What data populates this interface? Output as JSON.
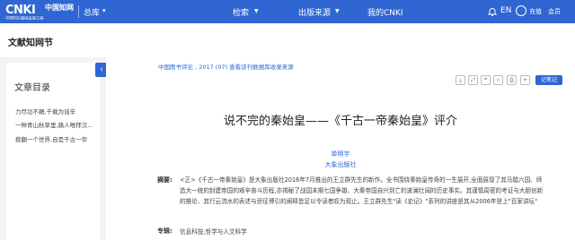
{
  "header": {
    "logo_mark": "CNKI",
    "logo_cn": "中国知网",
    "logo_sub": "中国知识基础设施工程",
    "home_label": "总库",
    "nav": [
      "检索",
      "出版来源",
      "我的CNKI"
    ],
    "lang": "EN",
    "recharge": "充值",
    "member": "会员"
  },
  "section_title": "文献知网节",
  "sidebar": {
    "title": "文章目录",
    "items": [
      "力尽功不赣,千载为谣辛",
      "一种青山秋草里,路人唯拜汉...",
      "掀翻一个世界,自是千古一帝"
    ]
  },
  "article": {
    "source": "中国图书评论 , 2017 (07)  查看该刊数据库收录来源",
    "note_button": "记笔记",
    "title": "说不完的秦始皇——《千古一帝秦始皇》评介",
    "author": "单明宇",
    "org": "大象出版社",
    "abstract_label": "摘要:",
    "abstract": "<正>《千古一帝秦始皇》是大象出版社2016年7月推出的王立群先生的新作。全书围绕秦始皇传奇的一生展开,全面展现了其马踏六国、缔造大一统的封建帝国的艰辛奋斗历程,亦揭秘了战国末期七国争雄、大秦帝国自兴到亡的波澜壮阔的历史事实。其谨慎周密的考证与大胆创新的推论、其行云流水的表述与旁征博引的阐释皆足以令读者叹为观止。王立群先生\"读《史记》\"系列的讲座是其从2006年登上\"百家讲坛\"",
    "keyword_label": "专辑:",
    "keywords": "信息科技;哲学与人文科学"
  }
}
